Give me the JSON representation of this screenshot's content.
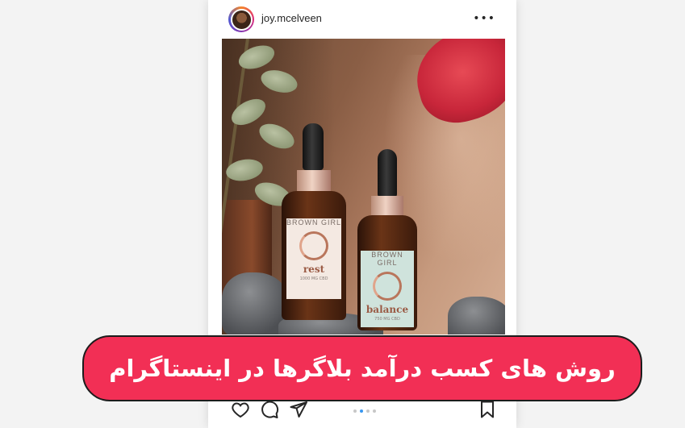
{
  "post": {
    "username": "joy.mcelveen",
    "more_icon": "more-horizontal-icon"
  },
  "photo": {
    "bottle_left": {
      "brand": "BROWN GIRL",
      "name": "rest",
      "sub": "1000 MG CBD"
    },
    "bottle_right": {
      "brand": "BROWN GIRL",
      "name": "balance",
      "sub": "750 MG CBD"
    }
  },
  "actions": {
    "icons": [
      "heart-icon",
      "comment-icon",
      "send-icon",
      "bookmark-icon"
    ],
    "carousel_active_index": 1,
    "carousel_count": 4
  },
  "banner": {
    "text": "روش های کسب درآمد بلاگرها در اینستاگرام",
    "background": "#f22f55"
  }
}
